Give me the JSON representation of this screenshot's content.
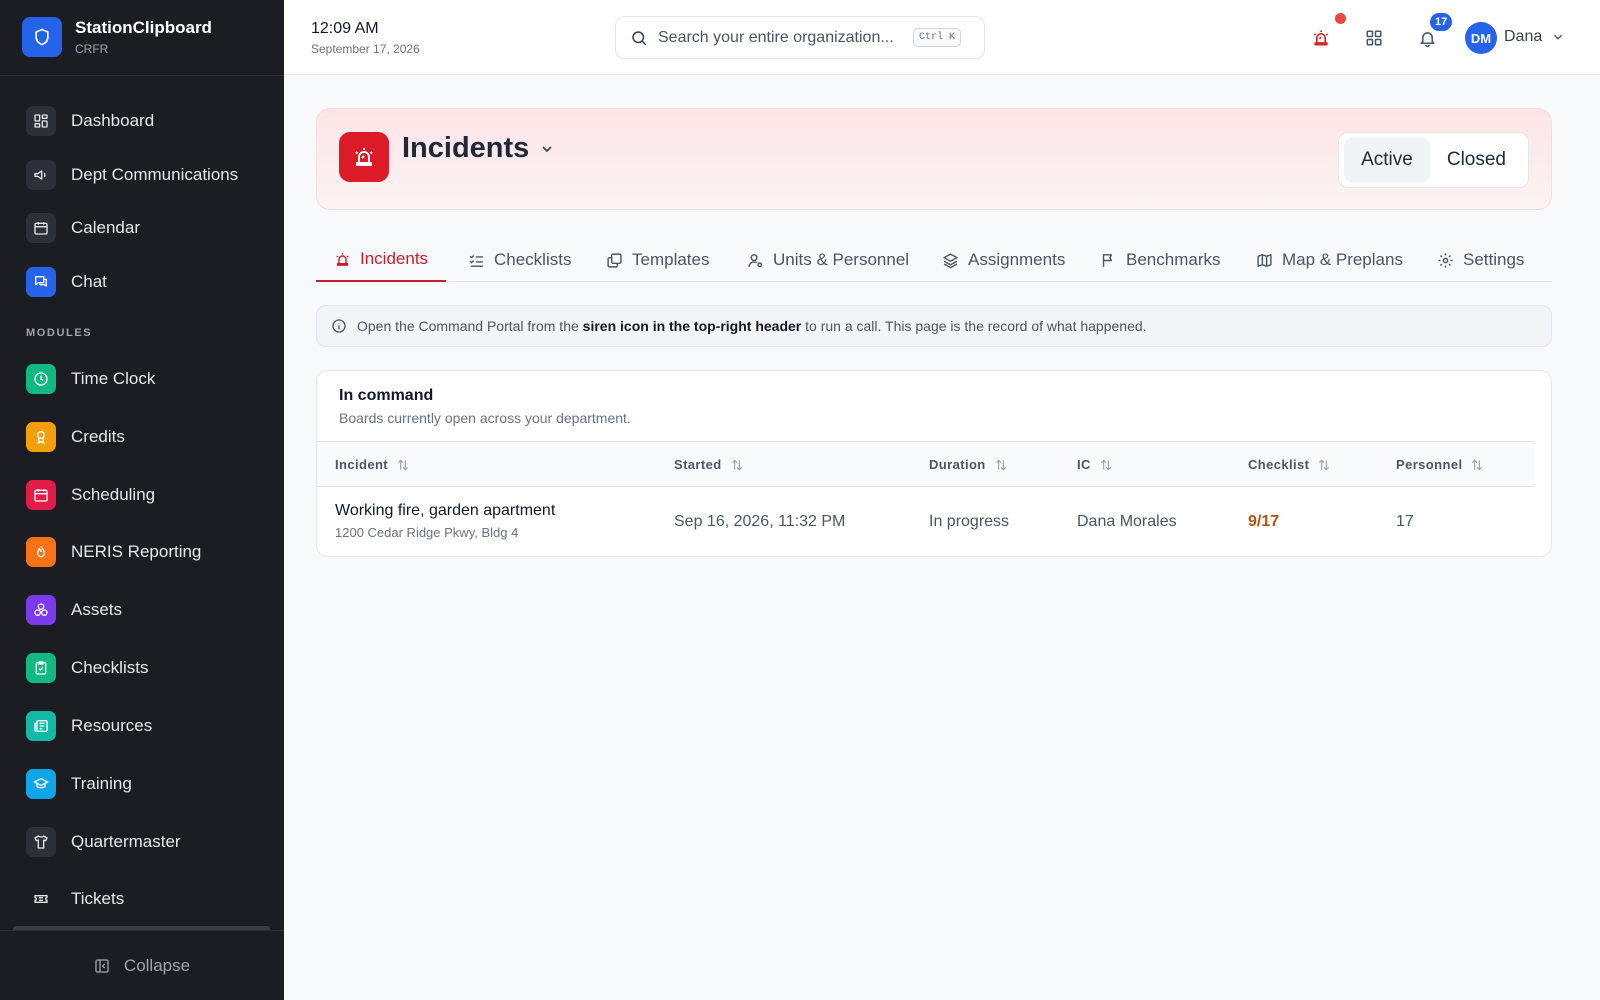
{
  "brand": {
    "name": "StationClipboard",
    "sub": "CRFR"
  },
  "sidebar": {
    "items": [
      {
        "label": "Dashboard"
      },
      {
        "label": "Dept Communications"
      },
      {
        "label": "Calendar"
      },
      {
        "label": "Chat"
      }
    ],
    "modules_label": "MODULES",
    "modules": [
      {
        "label": "Time Clock"
      },
      {
        "label": "Credits"
      },
      {
        "label": "Scheduling"
      },
      {
        "label": "NERIS Reporting"
      },
      {
        "label": "Assets"
      },
      {
        "label": "Checklists"
      },
      {
        "label": "Resources"
      },
      {
        "label": "Training"
      },
      {
        "label": "Quartermaster"
      },
      {
        "label": "Tickets"
      }
    ],
    "collapse_label": "Collapse"
  },
  "header": {
    "time": "12:09 AM",
    "date": "September 17, 2026",
    "search_placeholder": "Search your entire organization...",
    "shortcut": "Ctrl K",
    "notification_count": "17",
    "avatar_initials": "DM",
    "user_name": "Dana"
  },
  "page": {
    "title": "Incidents",
    "toggle": {
      "active": "Active",
      "closed": "Closed"
    },
    "tabs": [
      {
        "label": "Incidents"
      },
      {
        "label": "Checklists"
      },
      {
        "label": "Templates"
      },
      {
        "label": "Units & Personnel"
      },
      {
        "label": "Assignments"
      },
      {
        "label": "Benchmarks"
      },
      {
        "label": "Map & Preplans"
      },
      {
        "label": "Settings"
      }
    ],
    "info": {
      "prefix": "Open the Command Portal from the ",
      "bold": "siren icon in the top-right header",
      "suffix": " to run a call. This page is the record of what happened."
    }
  },
  "card": {
    "title": "In command",
    "subtitle": "Boards currently open across your department.",
    "columns": [
      "Incident",
      "Started",
      "Duration",
      "IC",
      "Checklist",
      "Personnel"
    ],
    "rows": [
      {
        "incident": "Working fire, garden apartment",
        "address": "1200 Cedar Ridge Pkwy, Bldg 4",
        "started": "Sep 16, 2026, 11:32 PM",
        "duration": "In progress",
        "ic": "Dana Morales",
        "checklist": "9/17",
        "personnel": "17"
      }
    ]
  },
  "colors": {
    "accent_red": "#c81e2a",
    "brand_blue": "#2563eb",
    "checklist_amber": "#b45309",
    "sidebar_bg": "#1b1d22"
  }
}
